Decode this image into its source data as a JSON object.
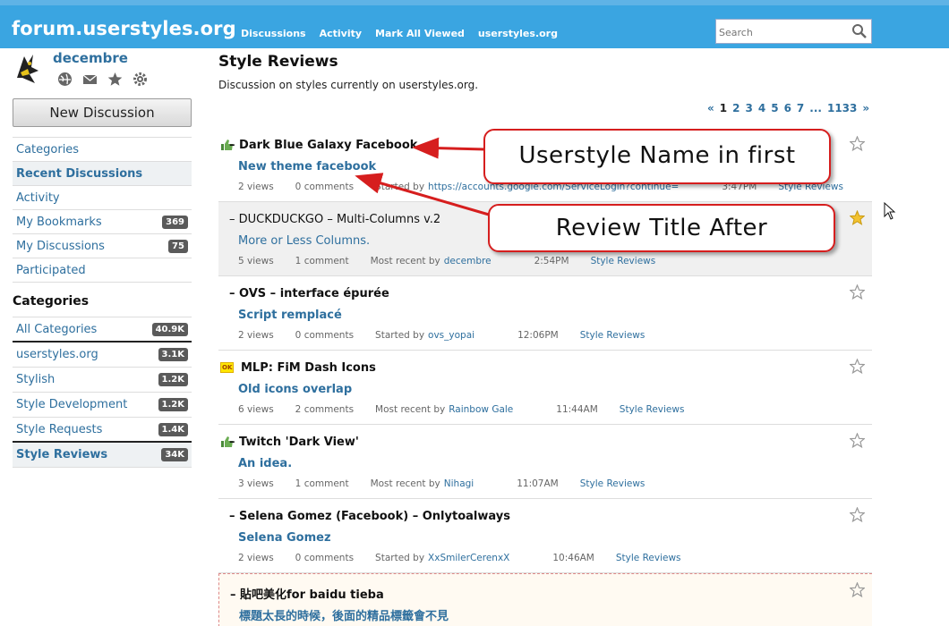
{
  "header": {
    "brand": "forum.userstyles.org",
    "nav": [
      "Discussions",
      "Activity",
      "Mark All Viewed",
      "userstyles.org"
    ],
    "search_placeholder": "Search"
  },
  "user": {
    "name": "decembre",
    "icons": [
      "globe-icon",
      "mail-icon",
      "star-icon",
      "gear-icon"
    ]
  },
  "sidebar": {
    "new_discussion": "New Discussion",
    "items": [
      {
        "label": "Categories",
        "count": ""
      },
      {
        "label": "Recent Discussions",
        "count": ""
      },
      {
        "label": "Activity",
        "count": ""
      },
      {
        "label": "My Bookmarks",
        "count": "369"
      },
      {
        "label": "My Discussions",
        "count": "75"
      },
      {
        "label": "Participated",
        "count": ""
      }
    ],
    "categories_heading": "Categories",
    "categories": [
      {
        "label": "All Categories",
        "count": "40.9K"
      },
      {
        "label": "userstyles.org",
        "count": "3.1K"
      },
      {
        "label": "Stylish",
        "count": "1.2K"
      },
      {
        "label": "Style Development",
        "count": "1.2K"
      },
      {
        "label": "Style Requests",
        "count": "1.4K"
      },
      {
        "label": "Style Reviews",
        "count": "34K"
      }
    ]
  },
  "main": {
    "title": "Style Reviews",
    "description": "Discussion on styles currently on userstyles.org.",
    "pager": [
      "«",
      "1",
      "2",
      "3",
      "4",
      "5",
      "6",
      "7",
      "...",
      "1133",
      "»"
    ],
    "discussions": [
      {
        "title": "– Dark Blue Galaxy Facebook",
        "subtitle": "New theme facebook",
        "views": "2 views",
        "comments": "0 comments",
        "by_label": "Started by",
        "by": "https://accounts.google.com/ServiceLogin?continue=",
        "time": "3:47PM",
        "category": "Style Reviews",
        "badge": "thumb-up-icon",
        "bookmarked": false
      },
      {
        "title": "– DUCKDUCKGO – Multi-Columns v.2",
        "subtitle": "More or Less Columns.",
        "views": "5 views",
        "comments": "1 comment",
        "by_label": "Most recent by",
        "by": "decembre",
        "time": "2:54PM",
        "category": "Style Reviews",
        "badge": "",
        "bookmarked": true
      },
      {
        "title": "– OVS – interface épurée",
        "subtitle": "Script remplacé",
        "views": "2 views",
        "comments": "0 comments",
        "by_label": "Started by",
        "by": "ovs_yopai",
        "time": "12:06PM",
        "category": "Style Reviews",
        "badge": "",
        "bookmarked": false
      },
      {
        "title": "MLP: FiM Dash Icons",
        "subtitle": "Old icons overlap",
        "views": "6 views",
        "comments": "2 comments",
        "by_label": "Most recent by",
        "by": "Rainbow Gale",
        "time": "11:44AM",
        "category": "Style Reviews",
        "badge": "OK",
        "bookmarked": false
      },
      {
        "title": "– Twitch 'Dark View'",
        "subtitle": "An idea.",
        "views": "3 views",
        "comments": "1 comment",
        "by_label": "Most recent by",
        "by": "Nihagi",
        "time": "11:07AM",
        "category": "Style Reviews",
        "badge": "thumb-up-icon",
        "bookmarked": false
      },
      {
        "title": "– Selena Gomez (Facebook) – Onlytoalways",
        "subtitle": "Selena Gomez",
        "views": "2 views",
        "comments": "0 comments",
        "by_label": "Started by",
        "by": "XxSmilerCerenxX",
        "time": "10:46AM",
        "category": "Style Reviews",
        "badge": "",
        "bookmarked": false
      },
      {
        "title": "– 貼吧美化for baidu tieba",
        "subtitle": "標題太長的時候，後面的精品標籤會不見",
        "views": "",
        "comments": "",
        "by_label": "",
        "by": "",
        "time": "",
        "category": "",
        "badge": "",
        "bookmarked": false
      }
    ]
  },
  "callouts": {
    "first": "Userstyle Name in first",
    "second": "Review Title After"
  },
  "colors": {
    "header": "#3aa5e1",
    "link": "#2e6f9e",
    "callout_border": "#d61e1e",
    "bookmark_star": "#f2c230"
  }
}
